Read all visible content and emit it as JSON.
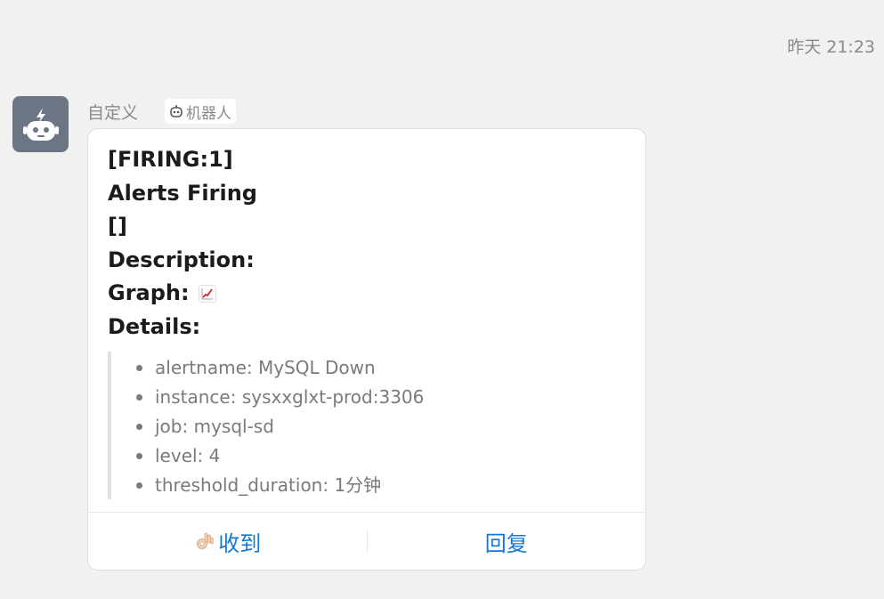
{
  "timestamp": "昨天 21:23",
  "sender": {
    "name": "自定义",
    "badge_label": "机器人",
    "avatar_icon": "robot-icon",
    "avatar_color": "#6b7583"
  },
  "message": {
    "title_lines": [
      "[FIRING:1]",
      "Alerts Firing",
      "[]",
      "Description:"
    ],
    "graph_label": "Graph:",
    "graph_icon": "chart-increasing-icon",
    "details_label": "Details:",
    "details": [
      "alertname: MySQL Down",
      "instance: sysxxglxt-prod:3306",
      "job: mysql-sd",
      "level: 4",
      "threshold_duration: 1分钟"
    ]
  },
  "actions": {
    "ack_label": "收到",
    "ack_icon": "ok-hand-icon",
    "reply_label": "回复",
    "link_color": "#1677d6"
  }
}
